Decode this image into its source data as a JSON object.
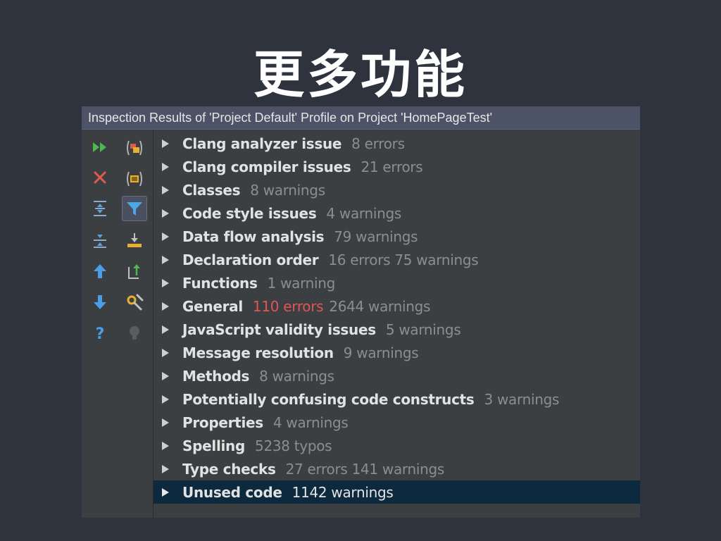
{
  "slide": {
    "title": "更多功能"
  },
  "window": {
    "title": "Inspection Results of 'Project Default' Profile on Project 'HomePageTest'"
  },
  "toolbar": {
    "left_column": [
      {
        "icon": "rerun-icon",
        "color": "#4db84d"
      },
      {
        "icon": "close-icon",
        "color": "#e05a4e"
      },
      {
        "icon": "expand-all-icon",
        "color": "#5aa4e0"
      },
      {
        "icon": "collapse-all-icon",
        "color": "#5aa4e0"
      },
      {
        "icon": "arrow-up-icon",
        "color": "#4a9ee8"
      },
      {
        "icon": "arrow-down-icon",
        "color": "#4a9ee8"
      },
      {
        "icon": "help-icon",
        "color": "#4a9ee8"
      }
    ],
    "right_column": [
      {
        "icon": "group-by-severity-icon"
      },
      {
        "icon": "group-by-directory-icon"
      },
      {
        "icon": "filter-icon",
        "active": true
      },
      {
        "icon": "import-icon"
      },
      {
        "icon": "export-icon"
      },
      {
        "icon": "edit-settings-icon"
      },
      {
        "icon": "lightbulb-icon"
      }
    ]
  },
  "results": [
    {
      "label": "Clang analyzer issue",
      "meta": "8 errors"
    },
    {
      "label": "Clang compiler issues",
      "meta": "21 errors"
    },
    {
      "label": "Classes",
      "meta": "8 warnings"
    },
    {
      "label": "Code style issues",
      "meta": "4 warnings"
    },
    {
      "label": "Data flow analysis",
      "meta": "79 warnings"
    },
    {
      "label": "Declaration order",
      "meta": "16 errors 75 warnings"
    },
    {
      "label": "Functions",
      "meta": "1 warning"
    },
    {
      "label": "General",
      "errors": "110 errors",
      "meta": "2644 warnings"
    },
    {
      "label": "JavaScript validity issues",
      "meta": "5 warnings"
    },
    {
      "label": "Message resolution",
      "meta": "9 warnings"
    },
    {
      "label": "Methods",
      "meta": "8 warnings"
    },
    {
      "label": "Potentially confusing code constructs",
      "meta": "3 warnings"
    },
    {
      "label": "Properties",
      "meta": "4 warnings"
    },
    {
      "label": "Spelling",
      "meta": "5238 typos"
    },
    {
      "label": "Type checks",
      "meta": "27 errors 141 warnings"
    },
    {
      "label": "Unused code",
      "meta": "1142 warnings",
      "selected": true
    }
  ],
  "colors": {
    "background": "#2f333d",
    "panel": "#3c3f41",
    "header": "#4c5367",
    "selection": "#0d293e",
    "error_text": "#e05555",
    "muted_text": "#8d8d8d"
  }
}
